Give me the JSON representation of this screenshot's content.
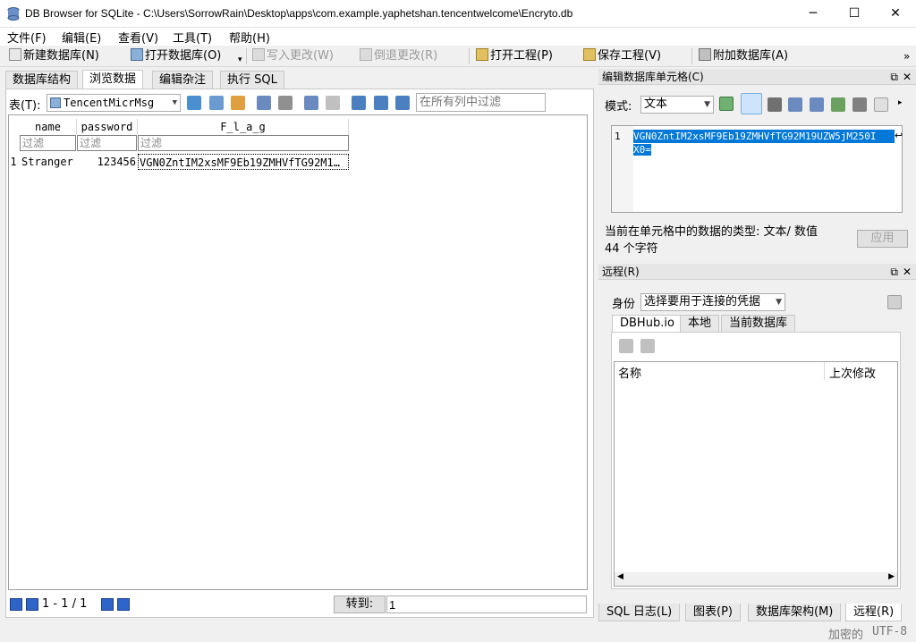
{
  "window": {
    "title": "DB Browser for SQLite - C:\\Users\\SorrowRain\\Desktop\\apps\\com.example.yaphetshan.tencentwelcome\\Encryto.db",
    "minimize": "─",
    "maximize": "☐",
    "close": "✕"
  },
  "menu": [
    "文件(F)",
    "编辑(E)",
    "查看(V)",
    "工具(T)",
    "帮助(H)"
  ],
  "toolbar": {
    "new_db": "新建数据库(N)",
    "open_db": "打开数据库(O)",
    "write_changes": "写入更改(W)",
    "revert_changes": "倒退更改(R)",
    "open_project": "打开工程(P)",
    "save_project": "保存工程(V)",
    "attach_db": "附加数据库(A)",
    "more": "»"
  },
  "main_tabs": [
    "数据库结构",
    "浏览数据",
    "编辑杂注",
    "执行 SQL"
  ],
  "browse": {
    "table_label": "表(T):",
    "table_name": "TencentMicrMsg",
    "filter_placeholder": "在所有列中过滤",
    "columns": [
      "name",
      "password",
      "F_l_a_g"
    ],
    "filter_text": "过滤",
    "rows": [
      {
        "num": "1",
        "name": "Stranger",
        "password": "123456",
        "flag": "VGN0ZntIM2xsMF9Eb19ZMHVfTG92M1…"
      }
    ],
    "pager": "1 - 1 / 1",
    "goto_label": "转到:",
    "goto_value": "1"
  },
  "edit_cell": {
    "header": "编辑数据库单元格(C)",
    "mode_label": "模式:",
    "mode_value": "文本",
    "line_no": "1",
    "content_line1": "VGN0ZntIM2xsMF9Eb19ZMHVfTG92M19UZW5jM250I",
    "content_line2": "X0=",
    "type_info": "当前在单元格中的数据的类型: 文本/ 数值",
    "size_info": "44 个字符",
    "apply": "应用"
  },
  "remote": {
    "header": "远程(R)",
    "identity_label": "身份",
    "identity_value": "选择要用于连接的凭据",
    "tabs": [
      "DBHub.io",
      "本地",
      "当前数据库"
    ],
    "col_name": "名称",
    "col_modified": "上次修改"
  },
  "bottom_tabs": [
    "SQL 日志(L)",
    "图表(P)",
    "数据库架构(M)",
    "远程(R)"
  ],
  "status": {
    "encryption": "加密的",
    "encoding": "UTF-8"
  },
  "colors": {
    "selection": "#0078d7",
    "nav_blue": "#2f64c8"
  }
}
